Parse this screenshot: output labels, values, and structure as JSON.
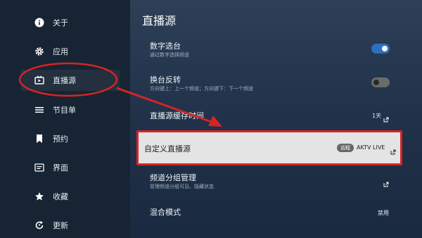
{
  "sidebar": {
    "items": [
      {
        "label": "关于",
        "icon": "info-icon"
      },
      {
        "label": "应用",
        "icon": "gear-icon"
      },
      {
        "label": "直播源",
        "icon": "tv-icon"
      },
      {
        "label": "节目单",
        "icon": "menu-icon"
      },
      {
        "label": "预约",
        "icon": "bookmark-icon"
      },
      {
        "label": "界面",
        "icon": "interface-icon"
      },
      {
        "label": "收藏",
        "icon": "star-icon"
      },
      {
        "label": "更新",
        "icon": "refresh-icon"
      }
    ]
  },
  "page": {
    "title": "直播源"
  },
  "settings": {
    "digit_select": {
      "title": "数字选台",
      "subtitle": "通过数字选择频道",
      "enabled": true
    },
    "reverse_switch": {
      "title": "换台反转",
      "subtitle": "方向键上：上一个频道；方向键下：下一个频道",
      "enabled": false
    },
    "cache_time": {
      "title": "直播源缓存时间",
      "value": "1天"
    },
    "custom_source": {
      "title": "自定义直播源",
      "badge": "远程",
      "value": "AKTV LIVE"
    },
    "group_manage": {
      "title": "频道分组管理",
      "subtitle": "管理频道分组可见、隐藏状态"
    },
    "mix_mode": {
      "title": "混合模式",
      "value": "禁用"
    }
  },
  "colors": {
    "accent": "#2f6fc0",
    "annotation": "#d62424",
    "toggle_off": "#6b6b6b"
  }
}
